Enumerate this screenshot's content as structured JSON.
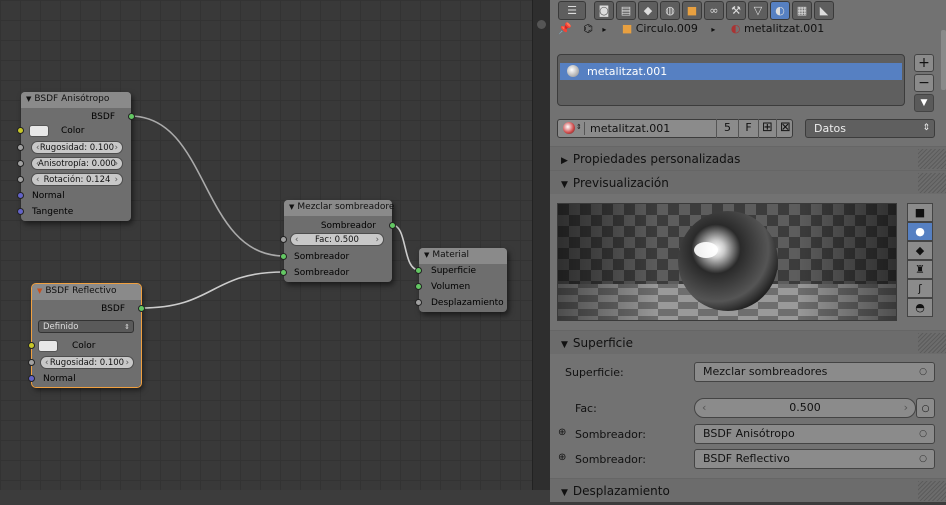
{
  "node_editor": {
    "node_aniso": {
      "title": "BSDF Anisótropo",
      "out": "BSDF",
      "color_label": "Color",
      "roughness": "Rugosidad: 0.100",
      "anisotropy": "Anisotropía: 0.000",
      "rotation": "Rotación: 0.124",
      "normal": "Normal",
      "tangent": "Tangente"
    },
    "node_reflect": {
      "title": "BSDF Reflectivo",
      "out": "BSDF",
      "distribution": "Definido",
      "color_label": "Color",
      "roughness": "Rugosidad: 0.100",
      "normal": "Normal"
    },
    "node_mix": {
      "title": "Mezclar sombreadore",
      "out": "Sombreador",
      "fac": "Fac: 0.500",
      "in1": "Sombreador",
      "in2": "Sombreador"
    },
    "node_output": {
      "title": "Material",
      "surface": "Superficie",
      "volume": "Volumen",
      "displacement": "Desplazamiento"
    }
  },
  "properties": {
    "header_icons": [
      "render-icon",
      "render-layers-icon",
      "scene-icon",
      "world-icon",
      "object-icon",
      "constraints-icon",
      "modifiers-icon",
      "data-icon",
      "material-icon",
      "texture-icon",
      "physics-icon"
    ],
    "breadcrumb": {
      "object": "Circulo.009",
      "material": "metalitzat.001"
    },
    "slot_name": "metalitzat.001",
    "material_name": "metalitzat.001",
    "users": "5",
    "fake_user": "F",
    "link_type": "Datos",
    "panels": {
      "custom_props": "Propiedades personalizadas",
      "preview": "Previsualización",
      "surface": "Superficie",
      "displacement": "Desplazamiento"
    },
    "surface": {
      "surface_label": "Superficie:",
      "surface_value": "Mezclar sombreadores",
      "fac_label": "Fac:",
      "fac_value": "0.500",
      "shader1_label": "Sombreador:",
      "shader1_value": "BSDF Anisótropo",
      "shader2_label": "Sombreador:",
      "shader2_value": "BSDF Reflectivo"
    }
  },
  "colors": {
    "accent": "#5680c2",
    "socket_shader": "#63c763",
    "socket_color": "#c7c729",
    "socket_value": "#a1a1a1",
    "socket_vector": "#6363c7",
    "selected_outline": "#f0a040"
  }
}
